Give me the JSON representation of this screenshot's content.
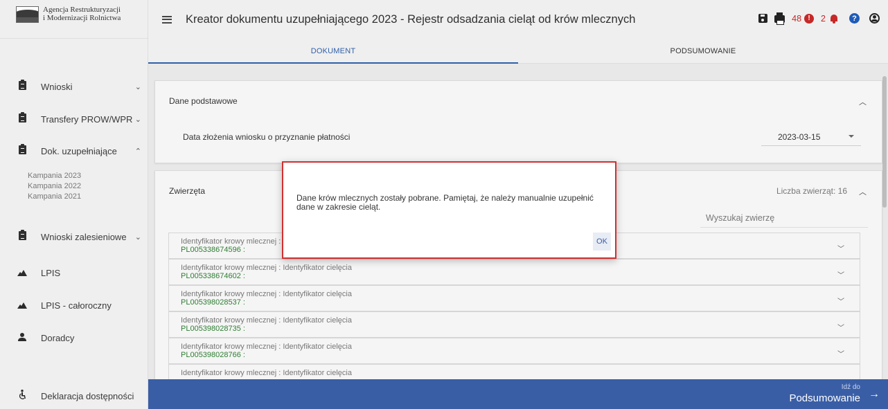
{
  "logo": {
    "line1": "Agencja Restrukturyzacji",
    "line2": "i Modernizacji Rolnictwa"
  },
  "header": {
    "title": "Kreator dokumentu uzupełniającego 2023 - Rejestr odsadzania cieląt od krów mlecznych",
    "error_count": "48",
    "error_icon_text": "!",
    "notification_count": "2",
    "help_icon_text": "?"
  },
  "sidebar": {
    "items": [
      {
        "label": "Wnioski",
        "icon": "clipboard-icon",
        "chevron": "⌄"
      },
      {
        "label": "Transfery PROW/WPR",
        "icon": "clipboard-icon",
        "chevron": "⌄"
      },
      {
        "label": "Dok. uzupełniające",
        "icon": "clipboard-icon",
        "chevron": "⌃"
      },
      {
        "label": "Wnioski zalesieniowe",
        "icon": "clipboard-icon",
        "chevron": "⌄"
      },
      {
        "label": "LPIS",
        "icon": "mountain-icon"
      },
      {
        "label": "LPIS - całoroczny",
        "icon": "mountain-icon"
      },
      {
        "label": "Doradcy",
        "icon": "person-icon"
      },
      {
        "label": "Deklaracja dostępności",
        "icon": "accessibility-icon"
      }
    ],
    "subitems": [
      "Kampania 2023",
      "Kampania 2022",
      "Kampania 2021"
    ]
  },
  "tabs": [
    {
      "label": "DOKUMENT",
      "active": true
    },
    {
      "label": "PODSUMOWANIE",
      "active": false
    }
  ],
  "basic_data": {
    "title": "Dane podstawowe",
    "field_label": "Data złożenia wniosku o przyznanie płatności",
    "field_value": "2023-03-15"
  },
  "animals": {
    "title": "Zwierzęta",
    "count_text": "Liczba zwierząt: 16",
    "search_placeholder": "Wyszukaj zwierzę",
    "rows": [
      {
        "label": "Identyfikator krowy mlecznej : Identyfikator cielęcia",
        "value": "PL005338674596 :"
      },
      {
        "label": "Identyfikator krowy mlecznej : Identyfikator cielęcia",
        "value": "PL005338674602 :"
      },
      {
        "label": "Identyfikator krowy mlecznej : Identyfikator cielęcia",
        "value": "PL005398028537 :"
      },
      {
        "label": "Identyfikator krowy mlecznej : Identyfikator cielęcia",
        "value": "PL005398028735 :"
      },
      {
        "label": "Identyfikator krowy mlecznej : Identyfikator cielęcia",
        "value": "PL005398028766 :"
      },
      {
        "label": "Identyfikator krowy mlecznej : Identyfikator cielęcia",
        "value": ""
      }
    ]
  },
  "footer": {
    "pre": "Idź do",
    "target": "Podsumowanie",
    "arrow": "→"
  },
  "modal": {
    "message": "Dane krów mlecznych zostały pobrane. Pamiętaj, że należy manualnie uzupełnić dane w zakresie cieląt.",
    "ok_label": "OK"
  },
  "colors": {
    "accent": "#2f5fa8",
    "footer_bar": "#3a5ea6",
    "error": "#c62828",
    "modal_border": "#d32f2f",
    "animal_id": "#2e7d32"
  }
}
